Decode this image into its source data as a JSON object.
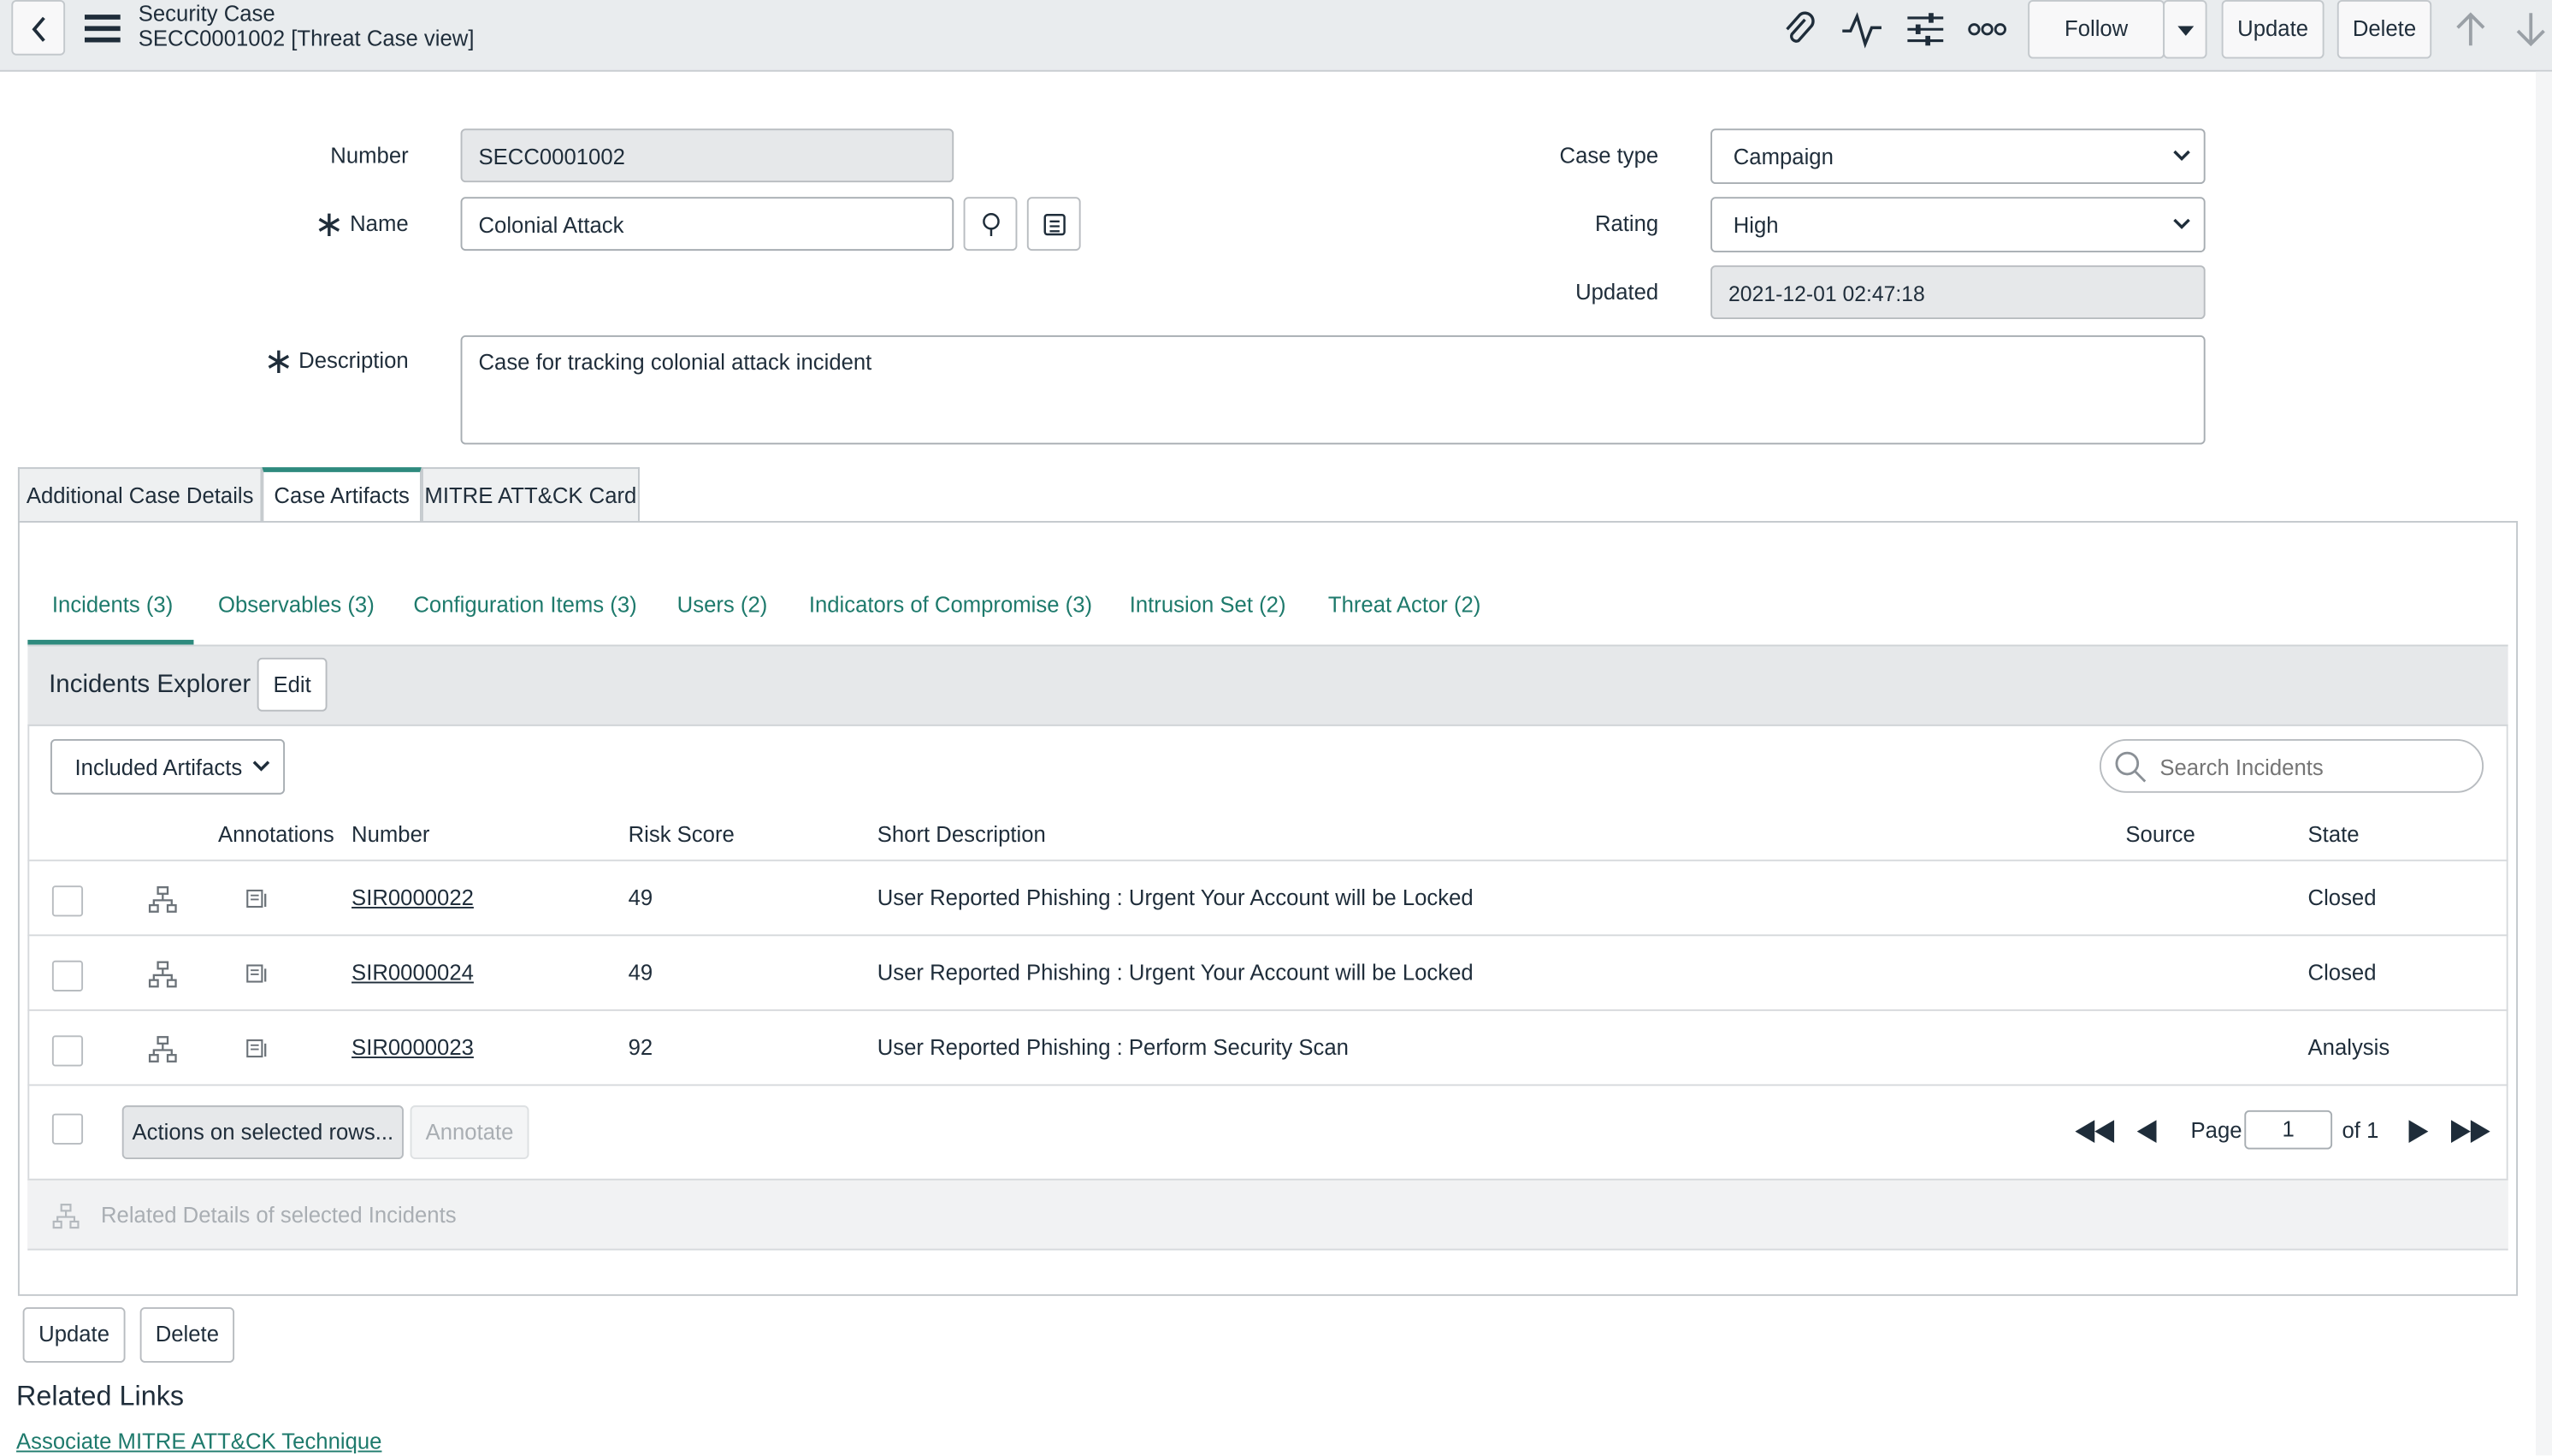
{
  "header": {
    "title": "Security Case",
    "subtitle": "SECC0001002 [Threat Case view]",
    "follow_label": "Follow",
    "update_label": "Update",
    "delete_label": "Delete",
    "icons": [
      "back-icon",
      "menu-icon",
      "paperclip-icon",
      "activity-icon",
      "personalize-icon",
      "more-icon",
      "chevron-down-icon",
      "arrow-up-icon",
      "arrow-down-icon"
    ]
  },
  "form": {
    "number_label": "Number",
    "number_value": "SECC0001002",
    "name_label": "Name",
    "name_value": "Colonial Attack",
    "description_label": "Description",
    "description_value": "Case for tracking colonial attack incident",
    "case_type_label": "Case type",
    "case_type_value": "Campaign",
    "rating_label": "Rating",
    "rating_value": "High",
    "updated_label": "Updated",
    "updated_value": "2021-12-01 02:47:18",
    "required_mark": "∗"
  },
  "tabs": [
    {
      "label": "Additional Case Details"
    },
    {
      "label": "Case Artifacts"
    },
    {
      "label": "MITRE ATT&CK Card"
    }
  ],
  "subtabs": [
    {
      "label": "Incidents (3)"
    },
    {
      "label": "Observables (3)"
    },
    {
      "label": "Configuration Items (3)"
    },
    {
      "label": "Users (2)"
    },
    {
      "label": "Indicators of Compromise (3)"
    },
    {
      "label": "Intrusion Set (2)"
    },
    {
      "label": "Threat Actor (2)"
    }
  ],
  "explorer": {
    "title": "Incidents Explorer",
    "edit_label": "Edit",
    "filter_value": "Included Artifacts",
    "search_placeholder": "Search Incidents",
    "columns": [
      "Annotations",
      "Number",
      "Risk Score",
      "Short Description",
      "Source",
      "State"
    ],
    "rows": [
      {
        "number": "SIR0000022",
        "risk": "49",
        "desc": "User Reported Phishing : Urgent Your Account will be Locked",
        "source": "",
        "state": "Closed"
      },
      {
        "number": "SIR0000024",
        "risk": "49",
        "desc": "User Reported Phishing : Urgent Your Account will be Locked",
        "source": "",
        "state": "Closed"
      },
      {
        "number": "SIR0000023",
        "risk": "92",
        "desc": "User Reported Phishing : Perform Security Scan",
        "source": "",
        "state": "Analysis"
      }
    ],
    "actions_label": "Actions on selected rows...",
    "annotate_label": "Annotate",
    "page_label": "Page",
    "page_value": "1",
    "of_label": "of 1",
    "related_details": "Related Details of selected Incidents"
  },
  "footer": {
    "update_label": "Update",
    "delete_label": "Delete",
    "related_links_title": "Related Links",
    "related_link": "Associate MITRE ATT&CK Technique"
  },
  "colors": {
    "accent": "#2e8a7e",
    "link": "#1e7a6c",
    "header_bg": "#e9ecee"
  }
}
